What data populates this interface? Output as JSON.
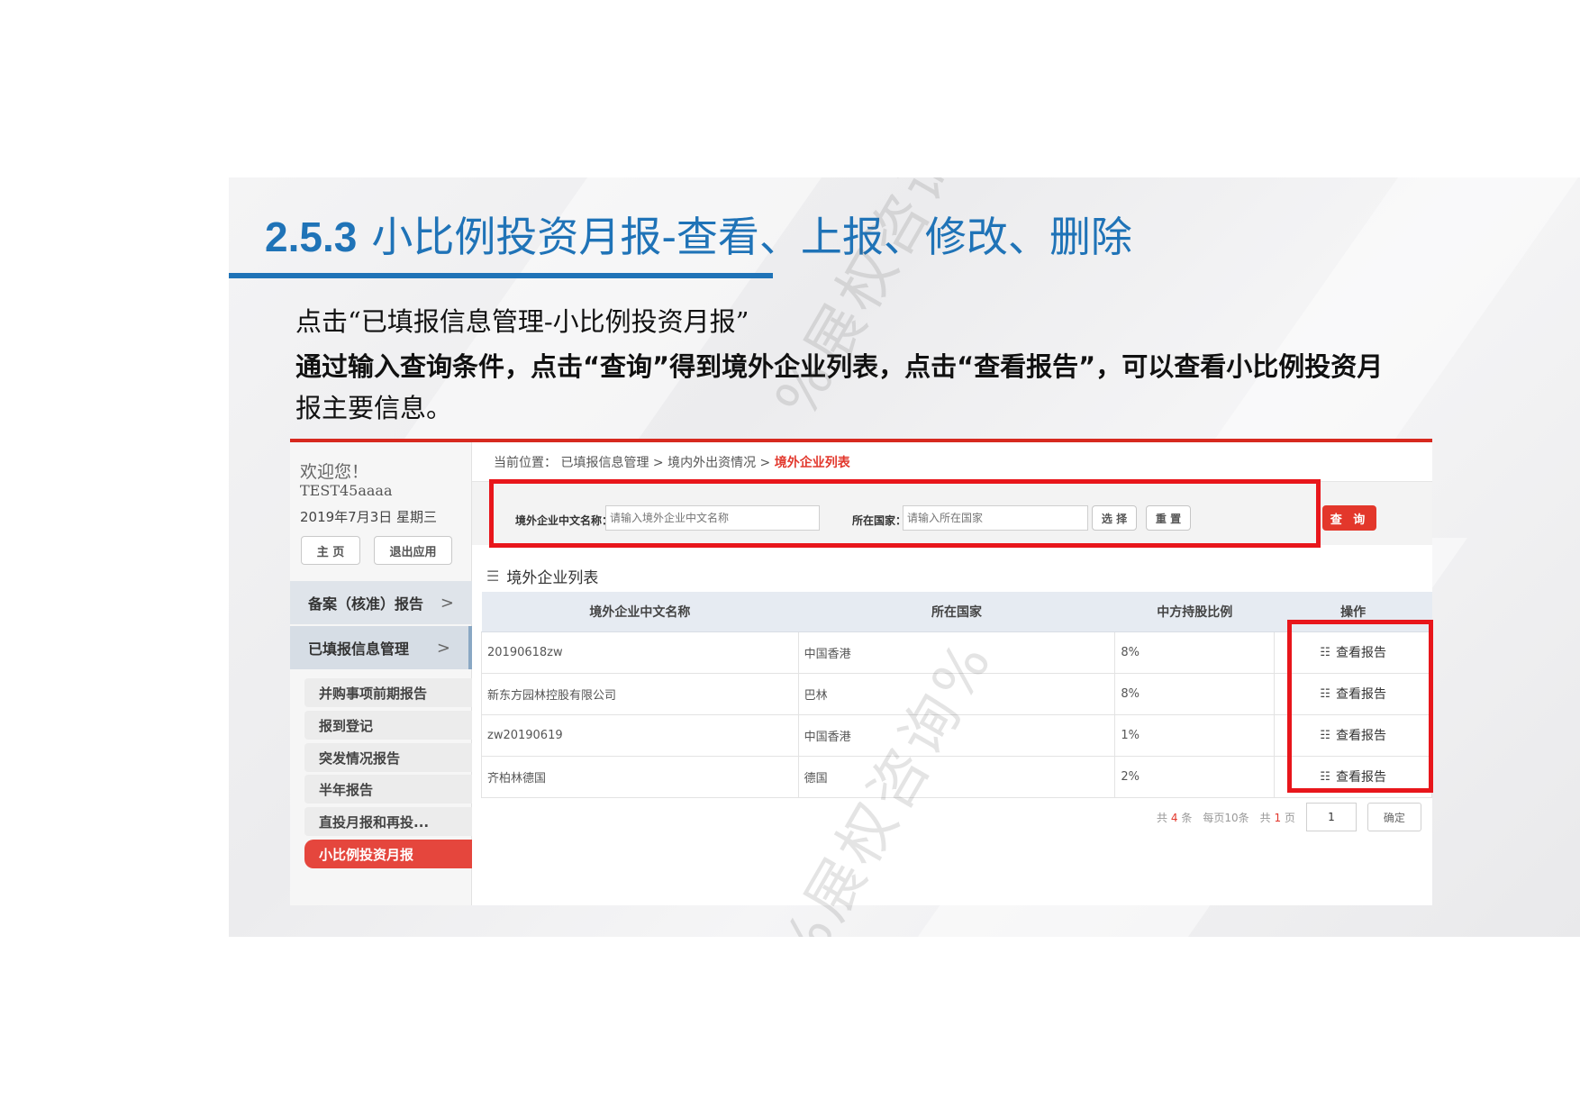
{
  "slide": {
    "title_number": "2.5.3",
    "title_text": "小比例投资月报-查看、上报、修改、删除",
    "paragraph1": "点击“已填报信息管理-小比例投资月报”",
    "paragraph2": "通过输入查询条件，点击“查询”得到境外企业列表，点击“查看报告”，可以查看小比例投资月",
    "paragraph3": "报主要信息。",
    "watermark": "%展权咨询%"
  },
  "sidebar": {
    "welcome": "欢迎您！",
    "username": "TEST45aaaa",
    "date": "2019年7月3日 星期三",
    "home_button": "主 页",
    "exit_button": "退出应用",
    "nav": [
      {
        "label": "备案（核准）报告",
        "chevron": ">"
      },
      {
        "label": "已填报信息管理",
        "chevron": ">"
      }
    ],
    "sub_items": [
      "并购事项前期报告",
      "报到登记",
      "突发情况报告",
      "半年报告",
      "直投月报和再投...",
      "小比例投资月报"
    ]
  },
  "breadcrumb": {
    "prefix": "当前位置：",
    "path": "已填报信息管理 > 境内外出资情况 >",
    "current": "境外企业列表"
  },
  "search": {
    "name_label": "境外企业中文名称：",
    "name_placeholder": "请输入境外企业中文名称",
    "country_label": "所在国家：",
    "country_placeholder": "请输入所在国家",
    "select_button": "选 择",
    "reset_button": "重 置",
    "query_button": "查 询"
  },
  "list": {
    "title": "境外企业列表",
    "columns": [
      "境外企业中文名称",
      "所在国家",
      "中方持股比例",
      "操作"
    ],
    "rows": [
      {
        "name": "20190618zw",
        "country": "中国香港",
        "ratio": "8%",
        "action": "查看报告"
      },
      {
        "name": "新东方园林控股有限公司",
        "country": "巴林",
        "ratio": "8%",
        "action": "查看报告"
      },
      {
        "name": "zw20190619",
        "country": "中国香港",
        "ratio": "1%",
        "action": "查看报告"
      },
      {
        "name": "齐柏林德国",
        "country": "德国",
        "ratio": "2%",
        "action": "查看报告"
      }
    ]
  },
  "pager": {
    "total_prefix": "共",
    "total_num": "4",
    "total_suffix": "条",
    "per_page": "每页10条",
    "pages_prefix": "共",
    "pages_num": "1",
    "pages_suffix": "页",
    "page_input": "1",
    "confirm": "确定"
  },
  "colors": {
    "accent_blue": "#1f73b7",
    "highlight_red": "#e8161b",
    "brand_red": "#e3372b"
  }
}
